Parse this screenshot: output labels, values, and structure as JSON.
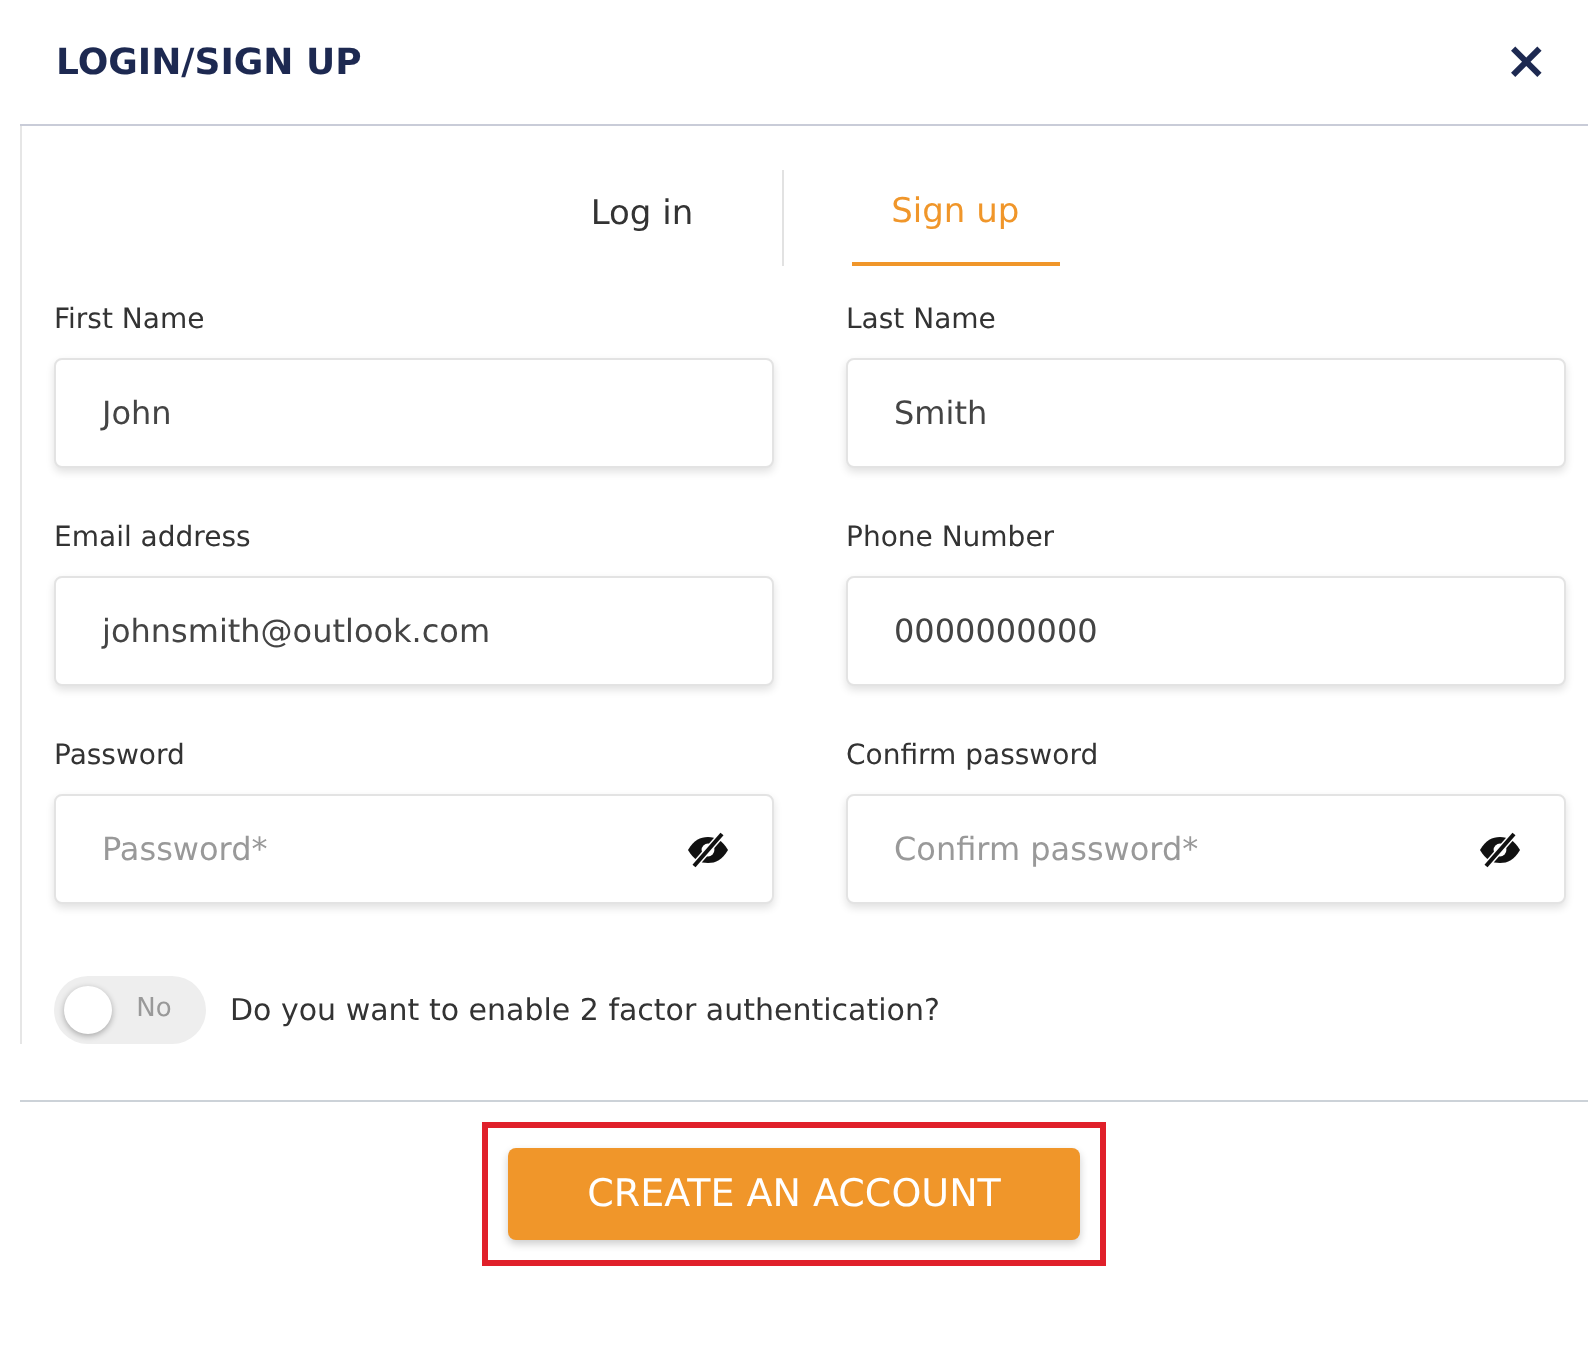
{
  "dialog": {
    "title": "LOGIN/SIGN UP",
    "close": "×"
  },
  "tabs": [
    {
      "label": "Log in",
      "selected": false
    },
    {
      "label": "Sign up",
      "selected": true
    }
  ],
  "fields": [
    {
      "kind": "text",
      "label": "First Name",
      "value": "John"
    },
    {
      "kind": "text",
      "label": "Last Name",
      "value": "Smith"
    },
    {
      "kind": "text",
      "label": "Email address",
      "value": "johnsmith@outlook.com"
    },
    {
      "kind": "text",
      "label": "Phone Number",
      "value": "0000000000"
    },
    {
      "kind": "password",
      "label": "Password",
      "placeholder": "Password*"
    },
    {
      "kind": "password",
      "label": "Confirm password",
      "placeholder": "Confirm password*"
    }
  ],
  "two_factor": {
    "on": false,
    "toggle_text": "No",
    "question": "Do you want to enable 2 factor authentication?"
  },
  "submit": {
    "label": "CREATE AN ACCOUNT",
    "highlighted": true
  }
}
